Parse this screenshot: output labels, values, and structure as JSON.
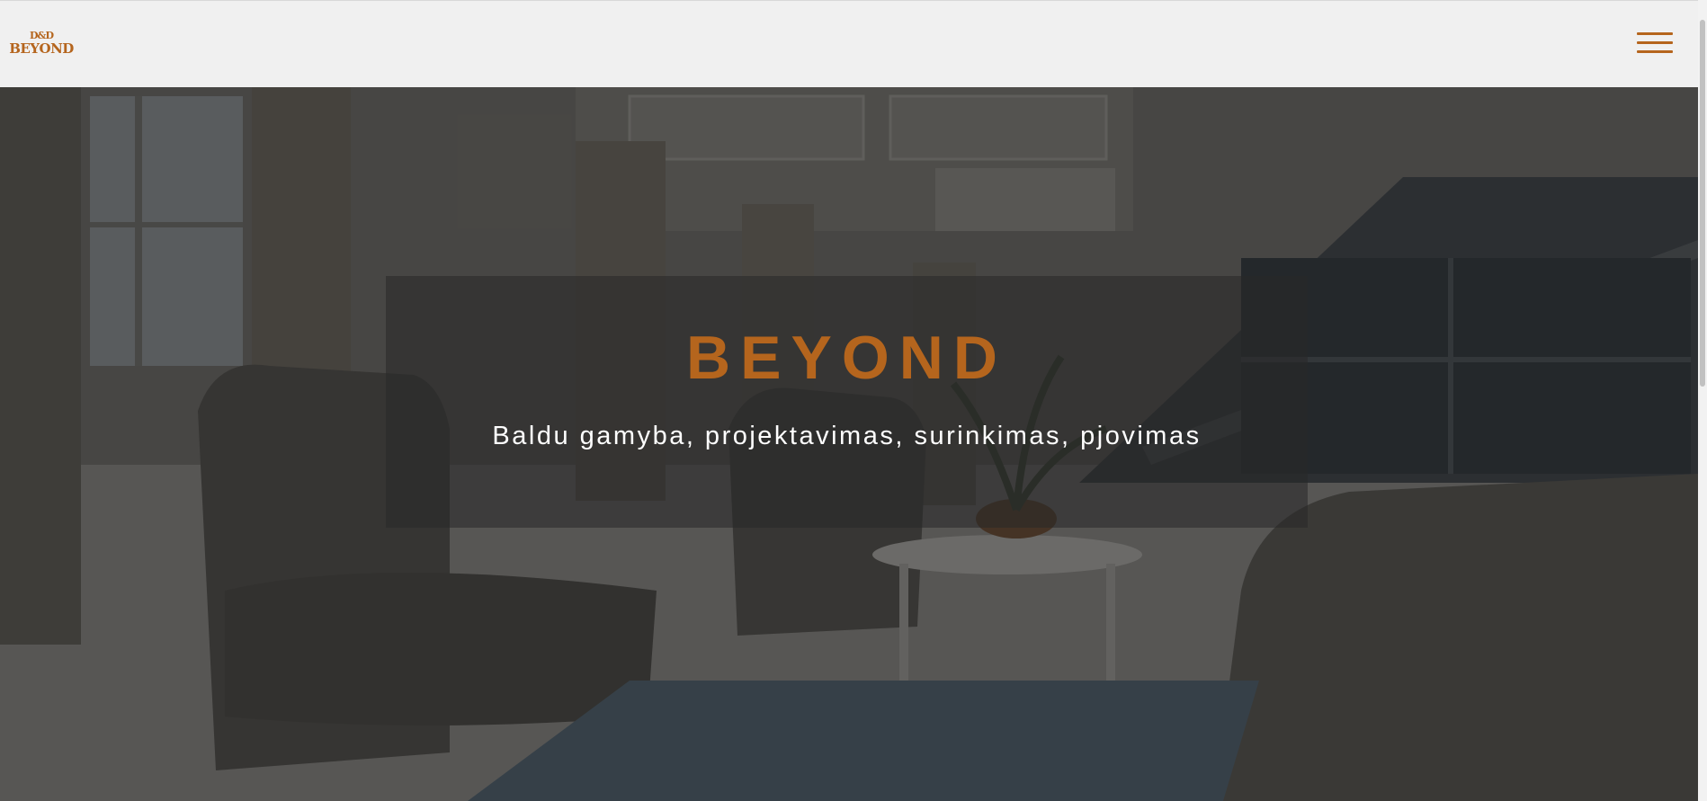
{
  "navbar": {
    "logo_mark": "D&D",
    "logo_text": "BEYOND",
    "menu_icon": "hamburger-menu-icon"
  },
  "hero": {
    "title": "BEYOND",
    "subtitle": "Baldu gamyba, projektavimas, surinkimas, pjovimas"
  },
  "colors": {
    "accent": "#b5651d",
    "navbar_bg": "#f0f0f0",
    "subtitle_text": "#ffffff"
  }
}
